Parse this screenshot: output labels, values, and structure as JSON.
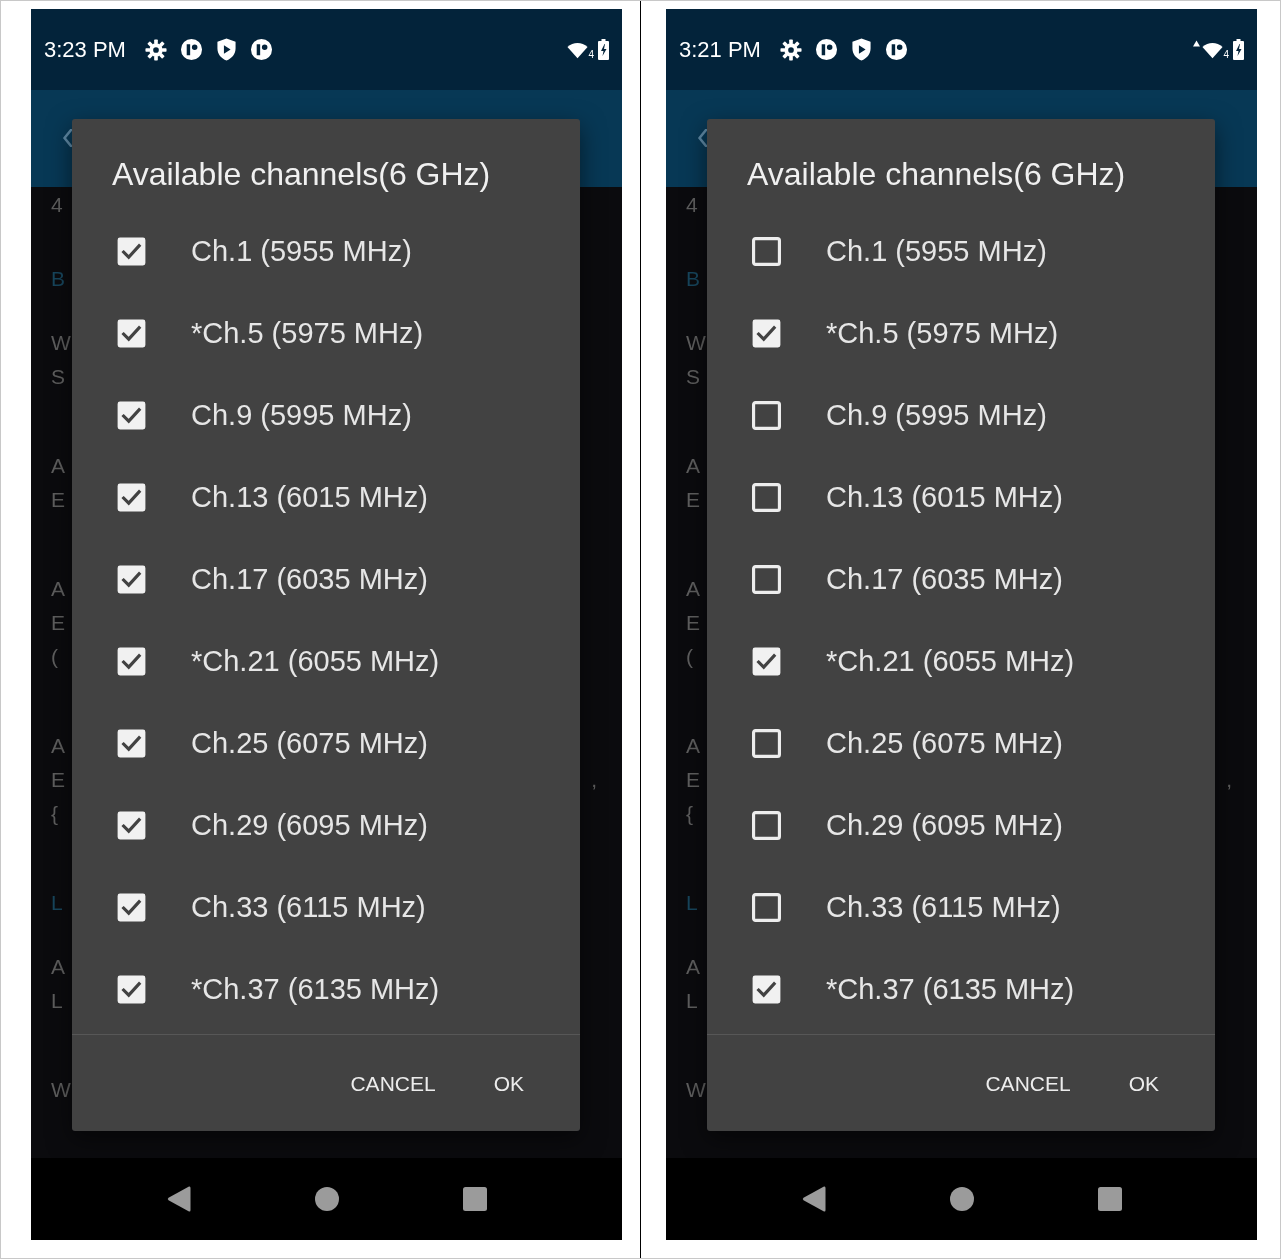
{
  "screens": [
    {
      "status_bar": {
        "time": "3:23 PM",
        "data_activity": false,
        "wifi_label": "4"
      },
      "background": {
        "groups": [
          {
            "kind": "value",
            "lines": [
              {
                "text": "4"
              }
            ]
          },
          {
            "kind": "header",
            "lines": [
              {
                "text": "B"
              }
            ]
          },
          {
            "kind": "item",
            "lines": [
              {
                "text": "W"
              },
              {
                "text": "S"
              }
            ]
          },
          {
            "kind": "item",
            "lines": [
              {
                "text": "A"
              },
              {
                "text": "E"
              }
            ]
          },
          {
            "kind": "item",
            "lines": [
              {
                "text": "A"
              },
              {
                "text": "E"
              },
              {
                "text": "("
              }
            ]
          },
          {
            "kind": "item",
            "lines": [
              {
                "text": "A"
              },
              {
                "text": "E",
                "tail": ","
              },
              {
                "text": "{"
              }
            ]
          },
          {
            "kind": "header",
            "lines": [
              {
                "text": "L"
              }
            ]
          },
          {
            "kind": "item",
            "lines": [
              {
                "text": "A"
              },
              {
                "text": "L"
              }
            ]
          },
          {
            "kind": "item",
            "lines": [
              {
                "text": "W"
              }
            ]
          }
        ]
      },
      "dialog": {
        "title": "Available channels(6 GHz)",
        "channels": [
          {
            "label": "Ch.1 (5955 MHz)",
            "checked": true
          },
          {
            "label": "*Ch.5 (5975 MHz)",
            "checked": true
          },
          {
            "label": "Ch.9 (5995 MHz)",
            "checked": true
          },
          {
            "label": "Ch.13 (6015 MHz)",
            "checked": true
          },
          {
            "label": "Ch.17 (6035 MHz)",
            "checked": true
          },
          {
            "label": "*Ch.21 (6055 MHz)",
            "checked": true
          },
          {
            "label": "Ch.25 (6075 MHz)",
            "checked": true
          },
          {
            "label": "Ch.29 (6095 MHz)",
            "checked": true
          },
          {
            "label": "Ch.33 (6115 MHz)",
            "checked": true
          },
          {
            "label": "*Ch.37 (6135 MHz)",
            "checked": true
          }
        ],
        "buttons": [
          {
            "label": "CANCEL"
          },
          {
            "label": "OK"
          }
        ]
      }
    },
    {
      "status_bar": {
        "time": "3:21 PM",
        "data_activity": true,
        "wifi_label": "4"
      },
      "background": {
        "groups": [
          {
            "kind": "value",
            "lines": [
              {
                "text": "4"
              }
            ]
          },
          {
            "kind": "header",
            "lines": [
              {
                "text": "B"
              }
            ]
          },
          {
            "kind": "item",
            "lines": [
              {
                "text": "W"
              },
              {
                "text": "S"
              }
            ]
          },
          {
            "kind": "item",
            "lines": [
              {
                "text": "A"
              },
              {
                "text": "E"
              }
            ]
          },
          {
            "kind": "item",
            "lines": [
              {
                "text": "A"
              },
              {
                "text": "E"
              },
              {
                "text": "("
              }
            ]
          },
          {
            "kind": "item",
            "lines": [
              {
                "text": "A"
              },
              {
                "text": "E",
                "tail": ","
              },
              {
                "text": "{"
              }
            ]
          },
          {
            "kind": "header",
            "lines": [
              {
                "text": "L"
              }
            ]
          },
          {
            "kind": "item",
            "lines": [
              {
                "text": "A"
              },
              {
                "text": "L"
              }
            ]
          },
          {
            "kind": "item",
            "lines": [
              {
                "text": "W"
              }
            ]
          }
        ]
      },
      "dialog": {
        "title": "Available channels(6 GHz)",
        "channels": [
          {
            "label": "Ch.1 (5955 MHz)",
            "checked": false
          },
          {
            "label": "*Ch.5 (5975 MHz)",
            "checked": true
          },
          {
            "label": "Ch.9 (5995 MHz)",
            "checked": false
          },
          {
            "label": "Ch.13 (6015 MHz)",
            "checked": false
          },
          {
            "label": "Ch.17 (6035 MHz)",
            "checked": false
          },
          {
            "label": "*Ch.21 (6055 MHz)",
            "checked": true
          },
          {
            "label": "Ch.25 (6075 MHz)",
            "checked": false
          },
          {
            "label": "Ch.29 (6095 MHz)",
            "checked": false
          },
          {
            "label": "Ch.33 (6115 MHz)",
            "checked": false
          },
          {
            "label": "*Ch.37 (6135 MHz)",
            "checked": true
          }
        ],
        "buttons": [
          {
            "label": "CANCEL"
          },
          {
            "label": "OK"
          }
        ]
      }
    }
  ]
}
